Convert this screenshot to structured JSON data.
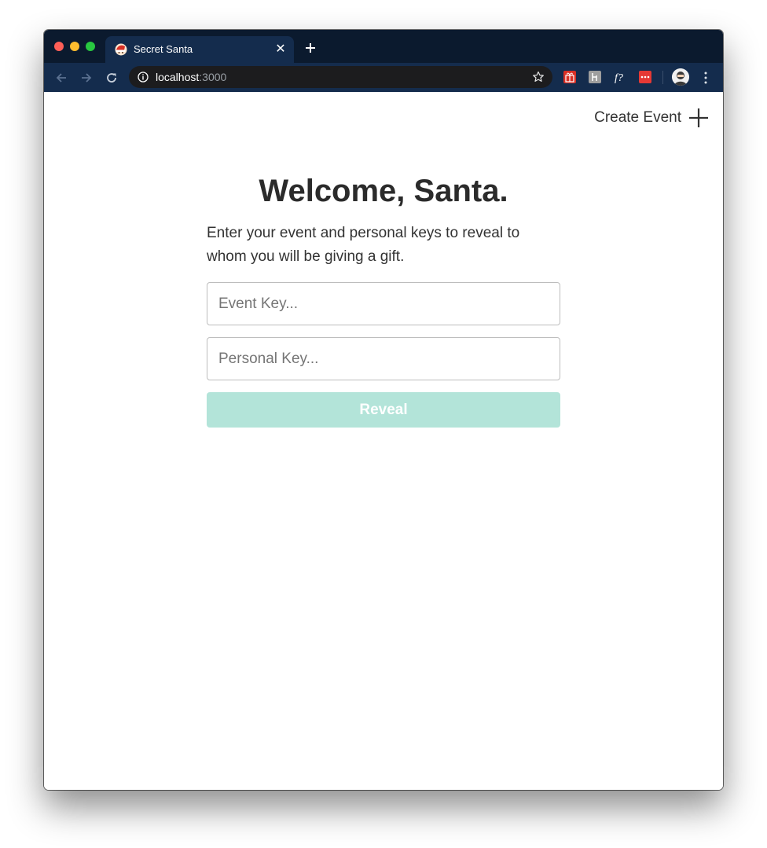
{
  "browser": {
    "tab": {
      "title": "Secret Santa",
      "favicon": "santa-hat-icon",
      "close_icon": "close-icon"
    },
    "new_tab_icon": "plus-icon",
    "address_bar": {
      "host": "localhost",
      "port": ":3000"
    },
    "colors": {
      "tabbar": "#0b1a2e",
      "toolbar": "#142c4d"
    }
  },
  "header": {
    "create_event_label": "Create Event",
    "create_event_icon": "plus-icon"
  },
  "main": {
    "title": "Welcome, Santa.",
    "instructions": "Enter your event and personal keys to reveal to whom you will be giving a gift.",
    "event_key": {
      "value": "",
      "placeholder": "Event Key..."
    },
    "personal_key": {
      "value": "",
      "placeholder": "Personal Key..."
    },
    "reveal_button_label": "Reveal",
    "accent_color": "#b3e4d9"
  }
}
